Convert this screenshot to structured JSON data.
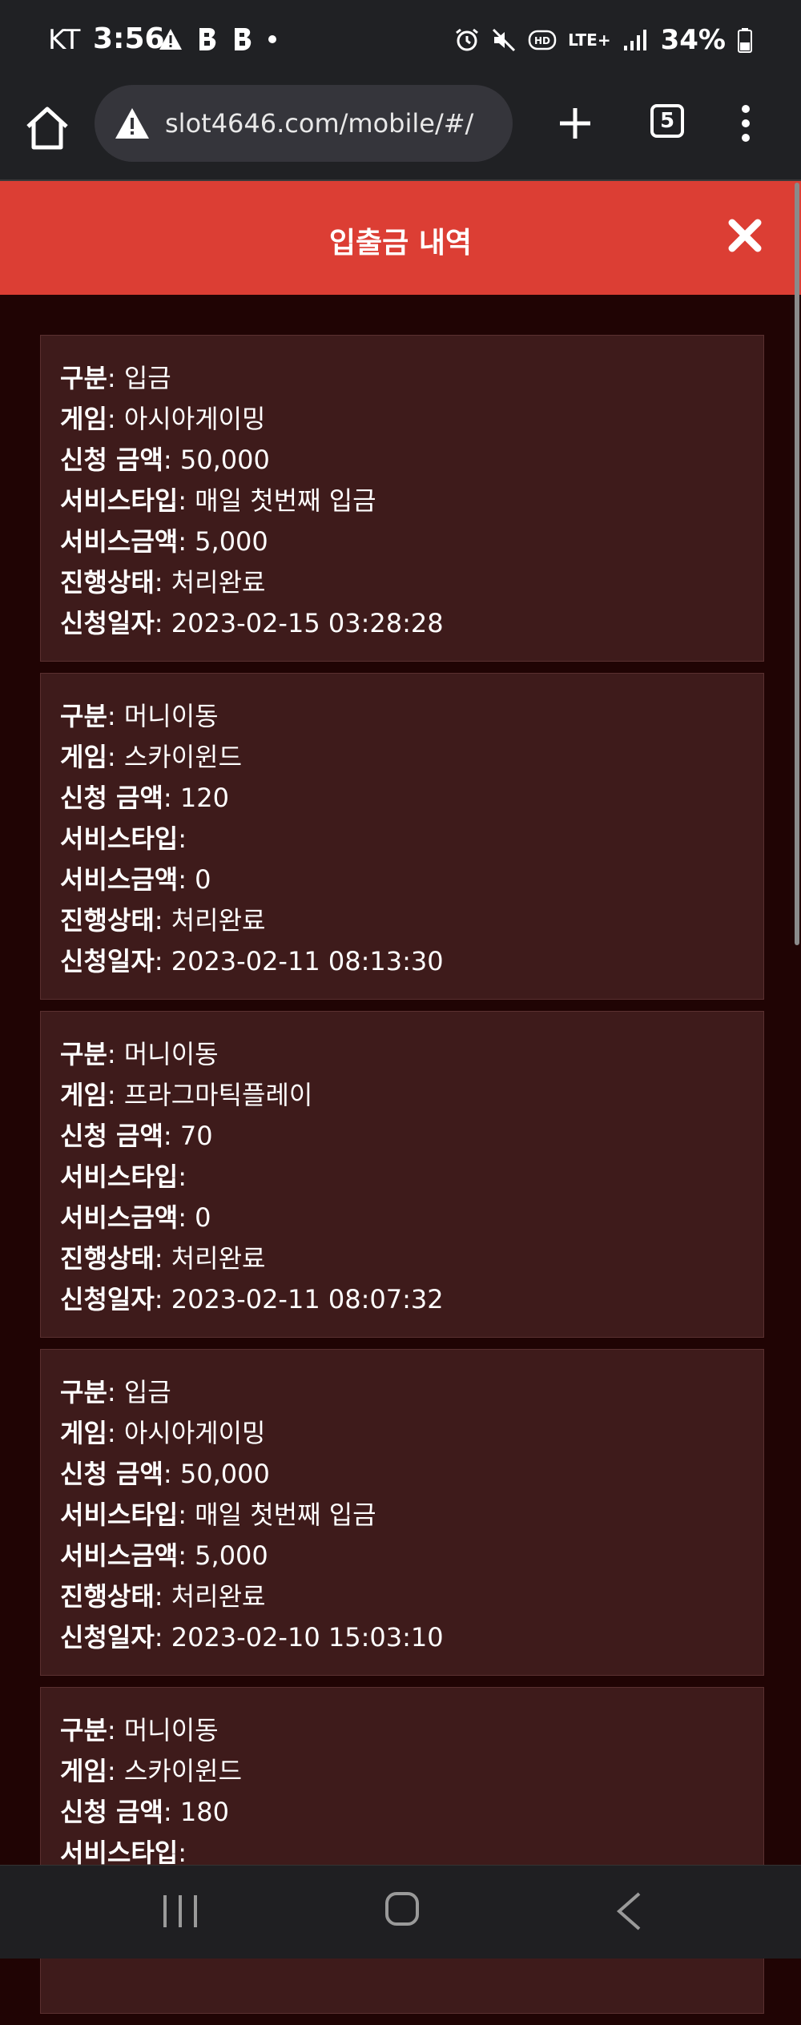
{
  "status_bar": {
    "carrier": "KT",
    "time": "3:56",
    "battery": "34%",
    "network": "LTE+",
    "icons": [
      "warning-icon",
      "b-app-icon",
      "b-app-icon",
      "dot-icon",
      "alarm-icon",
      "mute-icon",
      "hd-icon",
      "signal-icon",
      "battery-icon"
    ]
  },
  "browser": {
    "url": "slot4646.com/mobile/#/",
    "tab_count": "5"
  },
  "page": {
    "title": "입출금 내역"
  },
  "labels": {
    "type": "구분",
    "game": "게임",
    "amount": "신청 금액",
    "service_type": "서비스타입",
    "service_amount": "서비스금액",
    "status": "진행상태",
    "date": "신청일자"
  },
  "records": [
    {
      "type": "입금",
      "game": "아시아게이밍",
      "amount": "50,000",
      "service_type": "매일 첫번째 입금",
      "service_amount": "5,000",
      "status": "처리완료",
      "date": "2023-02-15 03:28:28"
    },
    {
      "type": "머니이동",
      "game": "스카이윈드",
      "amount": "120",
      "service_type": "",
      "service_amount": "0",
      "status": "처리완료",
      "date": "2023-02-11 08:13:30"
    },
    {
      "type": "머니이동",
      "game": "프라그마틱플레이",
      "amount": "70",
      "service_type": "",
      "service_amount": "0",
      "status": "처리완료",
      "date": "2023-02-11 08:07:32"
    },
    {
      "type": "입금",
      "game": "아시아게이밍",
      "amount": "50,000",
      "service_type": "매일 첫번째 입금",
      "service_amount": "5,000",
      "status": "처리완료",
      "date": "2023-02-10 15:03:10"
    },
    {
      "type": "머니이동",
      "game": "스카이윈드",
      "amount": "180",
      "service_type": ""
    }
  ],
  "colors": {
    "header_red": "#dc3e34",
    "page_bg": "#200404",
    "card_bg": "#3e1b1b",
    "chrome_bg": "#202124"
  }
}
